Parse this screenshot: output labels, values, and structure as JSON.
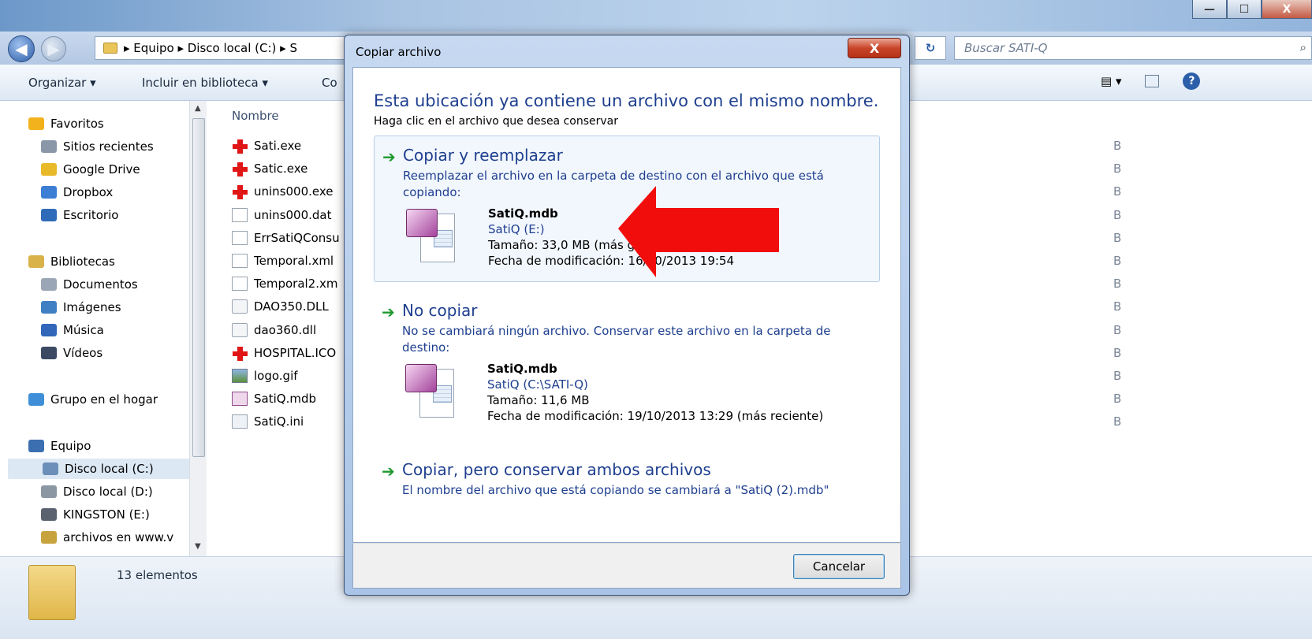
{
  "window": {
    "minimize_glyph": "—",
    "maximize_glyph": "☐",
    "close_glyph": "X"
  },
  "address": {
    "back_glyph": "◀",
    "forward_glyph": "▶",
    "breadcrumb": "▸ Equipo ▸ Disco local (C:) ▸ S",
    "refresh_glyph": "↻",
    "search_placeholder": "Buscar SATI-Q",
    "search_glyph": "⌕"
  },
  "toolbar": {
    "organize": "Organizar ▾",
    "include_library": "Incluir en biblioteca ▾",
    "truncated": "Co",
    "views_glyph": "▤ ▾",
    "help_glyph": "?"
  },
  "navpane": {
    "items": [
      {
        "label": "Favoritos",
        "icon": "star-icon",
        "color": "#f2b21d"
      },
      {
        "label": "Sitios recientes",
        "icon": "recent-places-icon",
        "color": "#8a97a8"
      },
      {
        "label": "Google Drive",
        "icon": "google-drive-icon",
        "color": "#e8b928"
      },
      {
        "label": "Dropbox",
        "icon": "dropbox-icon",
        "color": "#3c7ed4"
      },
      {
        "label": "Escritorio",
        "icon": "desktop-icon",
        "color": "#2f6bb8"
      },
      {
        "label": "Bibliotecas",
        "icon": "libraries-icon",
        "color": "#d9b24a"
      },
      {
        "label": "Documentos",
        "icon": "documents-icon",
        "color": "#9aa6b5"
      },
      {
        "label": "Imágenes",
        "icon": "pictures-icon",
        "color": "#3f7fc4"
      },
      {
        "label": "Música",
        "icon": "music-icon",
        "color": "#3166b8"
      },
      {
        "label": "Vídeos",
        "icon": "videos-icon",
        "color": "#3a4a63"
      },
      {
        "label": "Grupo en el hogar",
        "icon": "homegroup-icon",
        "color": "#3f8fd8"
      },
      {
        "label": "Equipo",
        "icon": "computer-icon",
        "color": "#3b6fb1"
      },
      {
        "label": "Disco local (C:)",
        "icon": "drive-c-icon",
        "color": "#6b8fb8"
      },
      {
        "label": "Disco local (D:)",
        "icon": "drive-d-icon",
        "color": "#8c97a4"
      },
      {
        "label": "KINGSTON (E:)",
        "icon": "usb-drive-icon",
        "color": "#5a6270"
      },
      {
        "label": "archivos en www.v",
        "icon": "network-folder-icon",
        "color": "#c7a33d"
      }
    ]
  },
  "filelist": {
    "column_name": "Nombre",
    "files": [
      {
        "name": "Sati.exe",
        "icon": "app-red-cross-icon"
      },
      {
        "name": "Satic.exe",
        "icon": "app-red-cross-icon"
      },
      {
        "name": "unins000.exe",
        "icon": "app-red-cross-icon"
      },
      {
        "name": "unins000.dat",
        "icon": "file-icon"
      },
      {
        "name": "ErrSatiQConsu",
        "icon": "text-file-icon"
      },
      {
        "name": "Temporal.xml",
        "icon": "file-icon"
      },
      {
        "name": "Temporal2.xm",
        "icon": "file-icon"
      },
      {
        "name": "DAO350.DLL",
        "icon": "dll-icon"
      },
      {
        "name": "dao360.dll",
        "icon": "dll-icon"
      },
      {
        "name": "HOSPITAL.ICO",
        "icon": "app-red-cross-icon"
      },
      {
        "name": "logo.gif",
        "icon": "image-file-icon"
      },
      {
        "name": "SatiQ.mdb",
        "icon": "access-db-icon"
      },
      {
        "name": "SatiQ.ini",
        "icon": "ini-file-icon"
      }
    ],
    "size_suffix": "B"
  },
  "status": {
    "count": "13 elementos"
  },
  "dialog": {
    "title": "Copiar archivo",
    "close_glyph": "X",
    "heading": "Esta ubicación ya contiene un archivo con el mismo nombre.",
    "subheading": "Haga clic en el archivo que desea conservar",
    "arrow_glyph": "➔",
    "options": {
      "replace": {
        "title": "Copiar y reemplazar",
        "desc": "Reemplazar el archivo en la carpeta de destino con el archivo que está copiando:",
        "file_name": "SatiQ.mdb",
        "file_location": "SatiQ (E:)",
        "file_size": "Tamaño: 33,0 MB (más grande)",
        "file_date": "Fecha de modificación: 16/10/2013 19:54"
      },
      "skip": {
        "title": "No copiar",
        "desc": "No se cambiará ningún archivo. Conservar este archivo en la carpeta de destino:",
        "file_name": "SatiQ.mdb",
        "file_location": "SatiQ (C:\\SATI-Q)",
        "file_size": "Tamaño: 11,6 MB",
        "file_date": "Fecha de modificación: 19/10/2013 13:29 (más reciente)"
      },
      "keep_both": {
        "title": "Copiar, pero conservar ambos archivos",
        "desc": "El nombre del archivo que está copiando se cambiará a \"SatiQ (2).mdb\""
      }
    },
    "cancel": "Cancelar"
  },
  "colors": {
    "dialog_blue_text": "#1e3f8f",
    "annotation_arrow": "#f20d0d",
    "option_arrow": "#1f9a2e"
  }
}
